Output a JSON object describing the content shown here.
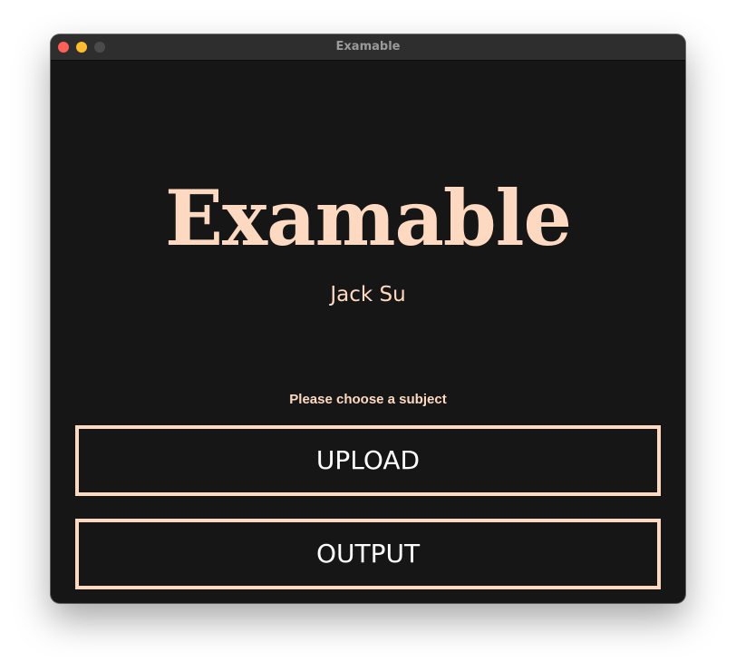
{
  "window": {
    "title": "Examable"
  },
  "main": {
    "app_title": "Examable",
    "author": "Jack Su",
    "prompt": "Please choose a subject",
    "upload_label": "UPLOAD",
    "output_label": "OUTPUT"
  },
  "colors": {
    "accent": "#fdd9c2",
    "background": "#161616",
    "titlebar": "#2e2e2e",
    "close": "#fe5f57",
    "minimize": "#febc2e",
    "zoom_disabled": "#4b4b4b"
  }
}
